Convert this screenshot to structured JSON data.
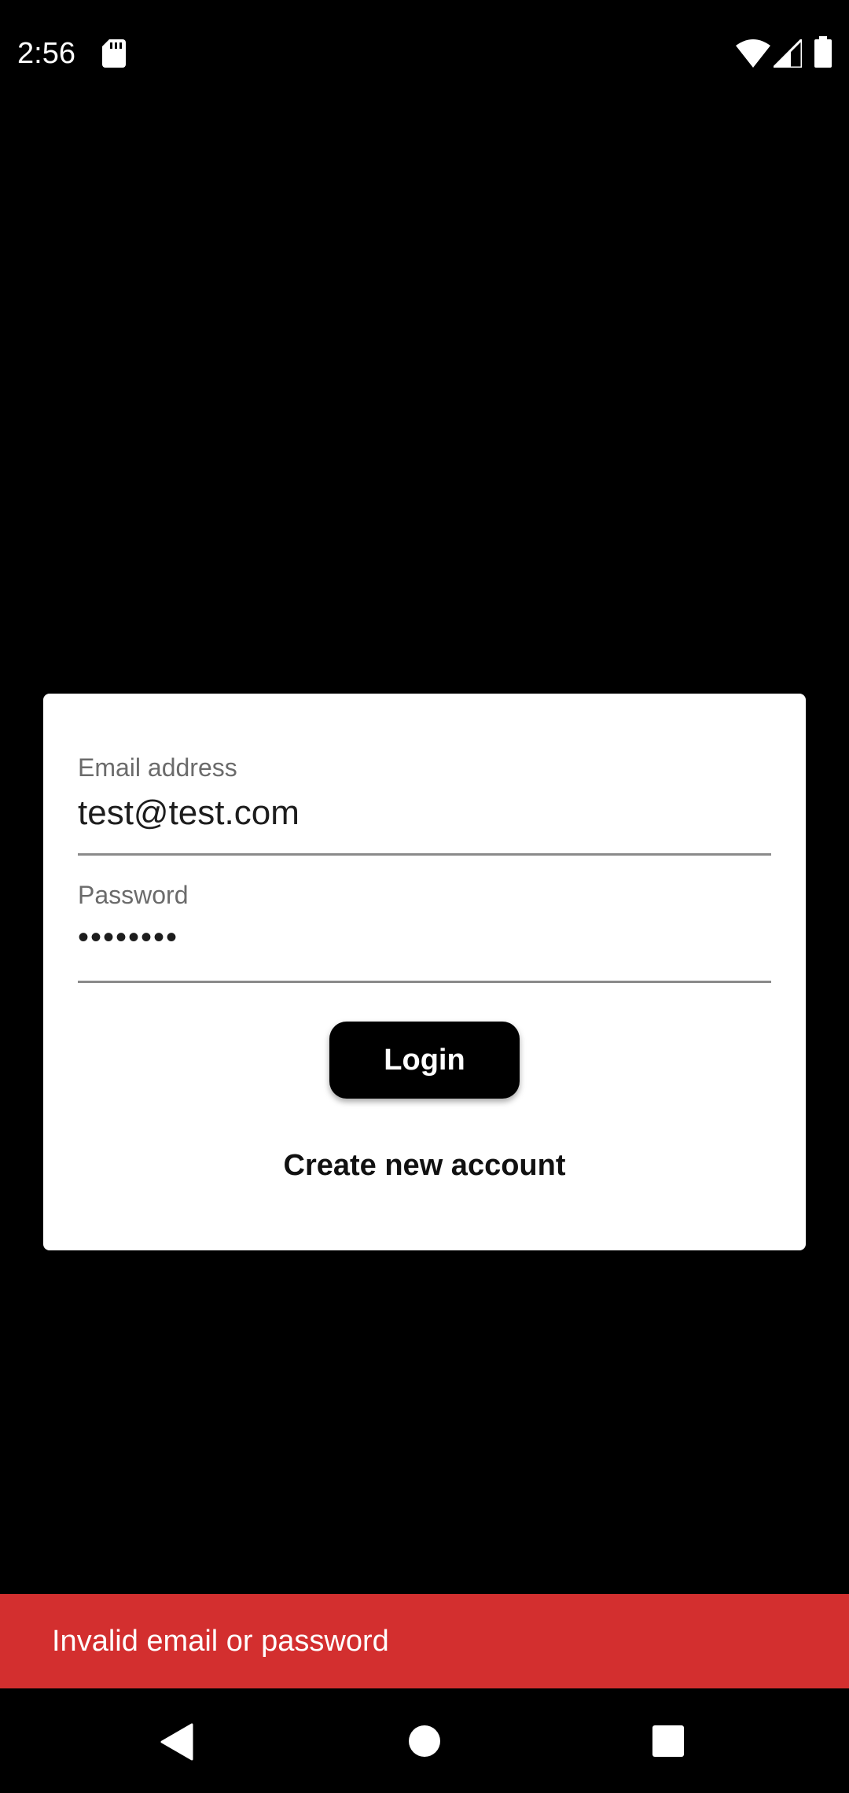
{
  "status_bar": {
    "time": "2:56",
    "icons": [
      "sd-card-icon",
      "wifi-icon",
      "cellular-signal-icon",
      "battery-icon"
    ]
  },
  "login_form": {
    "email": {
      "label": "Email address",
      "value": "test@test.com"
    },
    "password": {
      "label": "Password",
      "value": "••••••••"
    },
    "login_button_label": "Login",
    "create_account_label": "Create new account"
  },
  "snackbar": {
    "message": "Invalid email or password",
    "color": "#d32f2f"
  },
  "nav_bar": {
    "icons": [
      "back-icon",
      "home-icon",
      "recents-icon"
    ]
  },
  "colors": {
    "background": "#000000",
    "card": "#ffffff",
    "button": "#000000",
    "error": "#d32f2f"
  }
}
